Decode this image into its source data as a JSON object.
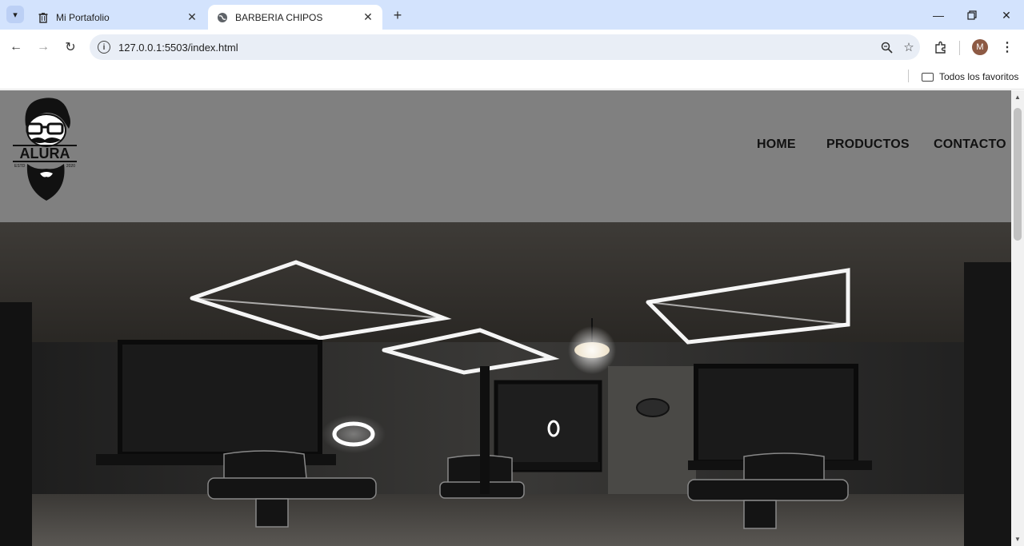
{
  "browser": {
    "tabs": [
      {
        "title": "Mi Portafolio",
        "favicon": "trash-icon",
        "active": false
      },
      {
        "title": "BARBERIA CHIPOS",
        "favicon": "globe-icon",
        "active": true
      }
    ],
    "url": "127.0.0.1:5503/index.html",
    "profile_initial": "M",
    "bookmarks_folder": "Todos los favoritos"
  },
  "site": {
    "logo": {
      "brand": "ALURA",
      "est_left": "ESTD",
      "est_right": "2020"
    },
    "nav": [
      "HOME",
      "PRODUCTOS",
      "CONTACTO"
    ],
    "header_color": "#808080"
  }
}
